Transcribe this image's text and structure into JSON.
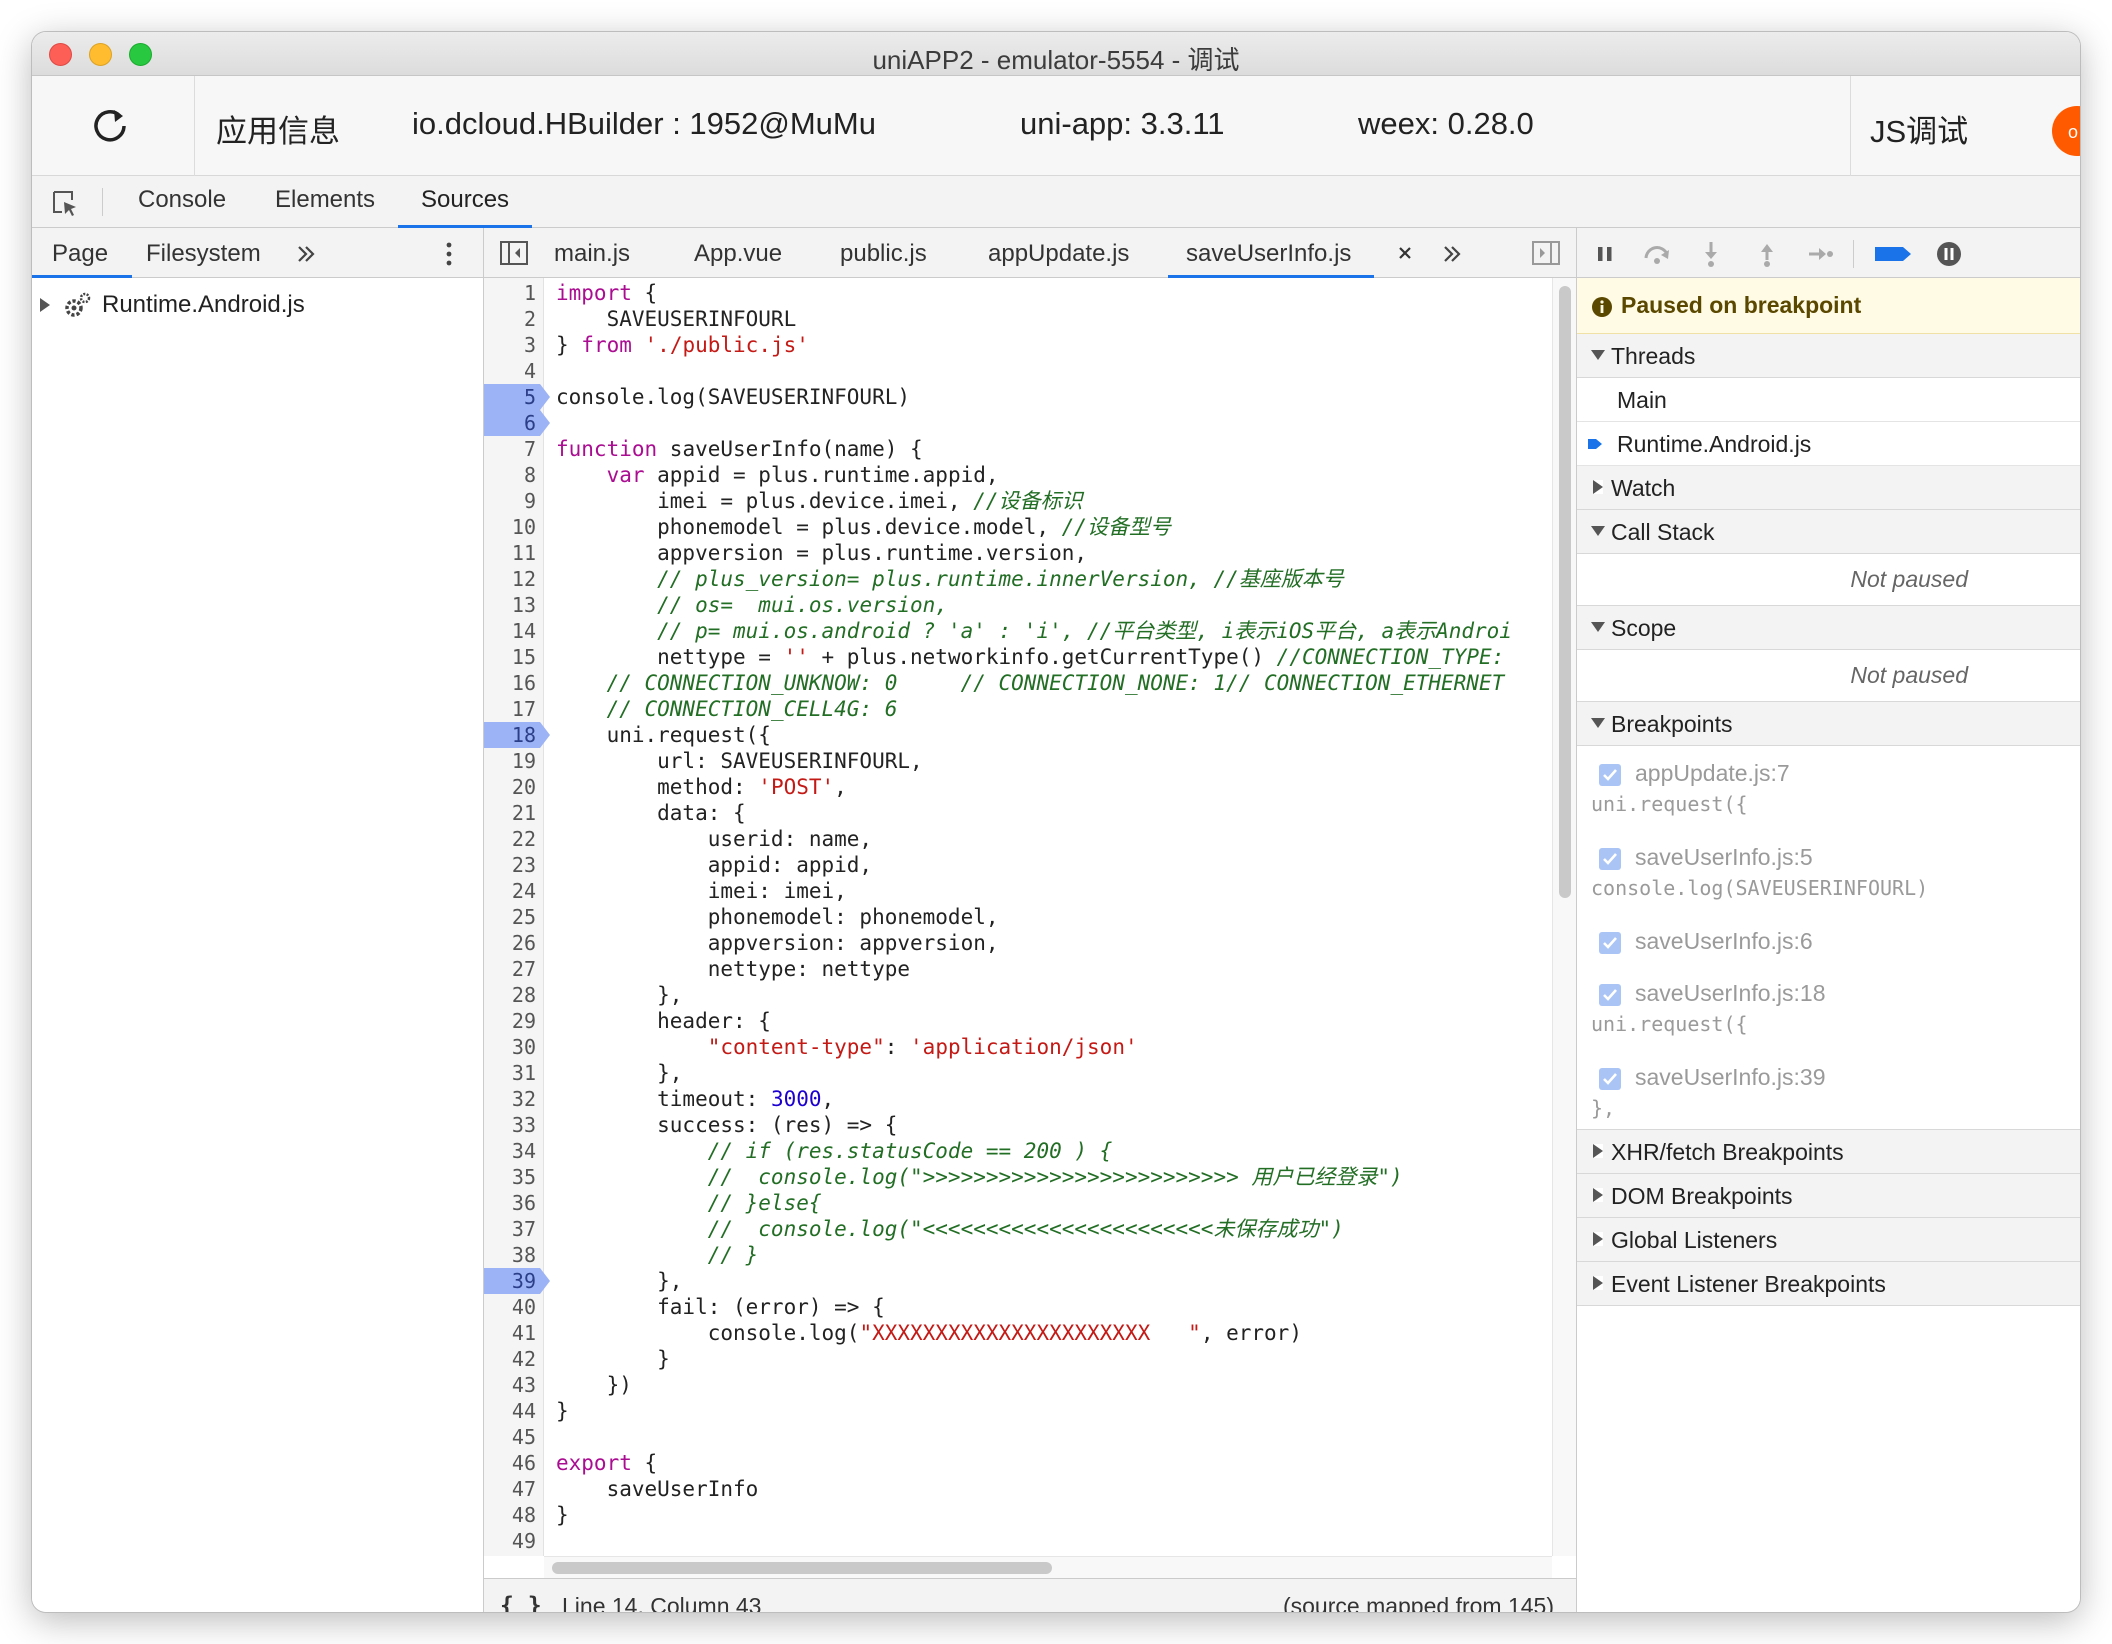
{
  "window": {
    "title": "uniAPP2 - emulator-5554 - 调试"
  },
  "infobar": {
    "app_info_label": "应用信息",
    "package": "io.dcloud.HBuilder : 1952@MuMu",
    "uniapp_version": "uni-app: 3.3.11",
    "weex_version": "weex: 0.28.0",
    "js_debug_label": "JS调试",
    "avatar_letter": "o"
  },
  "tabs": [
    "Console",
    "Elements",
    "Sources"
  ],
  "left_panel": {
    "tabs": [
      "Page",
      "Filesystem"
    ],
    "tree": [
      "Runtime.Android.js"
    ]
  },
  "file_tabs": [
    "main.js",
    "App.vue",
    "public.js",
    "appUpdate.js",
    "saveUserInfo.js"
  ],
  "code": {
    "lines": [
      "import {",
      "    SAVEUSERINFOURL",
      "} from './public.js'",
      "",
      "console.log(SAVEUSERINFOURL)",
      "",
      "function saveUserInfo(name) {",
      "    var appid = plus.runtime.appid,",
      "        imei = plus.device.imei, //设备标识",
      "        phonemodel = plus.device.model, //设备型号",
      "        appversion = plus.runtime.version,",
      "        // plus_version= plus.runtime.innerVersion, //基座版本号",
      "        // os=  mui.os.version,",
      "        // p= mui.os.android ? 'a' : 'i', //平台类型, i表示iOS平台, a表示Androi",
      "        nettype = '' + plus.networkinfo.getCurrentType() //CONNECTION_TYPE:",
      "    // CONNECTION_UNKNOW: 0     // CONNECTION_NONE: 1// CONNECTION_ETHERNET",
      "    // CONNECTION_CELL4G: 6",
      "    uni.request({",
      "        url: SAVEUSERINFOURL,",
      "        method: 'POST',",
      "        data: {",
      "            userid: name,",
      "            appid: appid,",
      "            imei: imei,",
      "            phonemodel: phonemodel,",
      "            appversion: appversion,",
      "            nettype: nettype",
      "        },",
      "        header: {",
      "            \"content-type\": 'application/json'",
      "        },",
      "        timeout: 3000,",
      "        success: (res) => {",
      "            // if (res.statusCode == 200 ) {",
      "            //  console.log(\">>>>>>>>>>>>>>>>>>>>>>>>> 用户已经登录\")",
      "            // }else{",
      "            //  console.log(\"<<<<<<<<<<<<<<<<<<<<<<<未保存成功\")",
      "            // }",
      "        },",
      "        fail: (error) => {",
      "            console.log(\"XXXXXXXXXXXXXXXXXXXXXX   \", error)",
      "        }",
      "    })",
      "}",
      "",
      "export {",
      "    saveUserInfo",
      "}",
      ""
    ],
    "breakpoint_lines": [
      5,
      6,
      18,
      39
    ]
  },
  "status": {
    "position": "Line 14, Column 43",
    "source_map": "(source mapped from 145)",
    "pretty_icon": "{ }"
  },
  "debugger": {
    "paused_msg": "Paused on breakpoint",
    "threads_label": "Threads",
    "threads": [
      "Main",
      "Runtime.Android.js"
    ],
    "watch_label": "Watch",
    "callstack_label": "Call Stack",
    "callstack_status": "Not paused",
    "scope_label": "Scope",
    "scope_status": "Not paused",
    "breakpoints_label": "Breakpoints",
    "breakpoints": [
      {
        "name": "appUpdate.js:7",
        "code": "uni.request({"
      },
      {
        "name": "saveUserInfo.js:5",
        "code": "console.log(SAVEUSERINFOURL)"
      },
      {
        "name": "saveUserInfo.js:6",
        "code": ""
      },
      {
        "name": "saveUserInfo.js:18",
        "code": "uni.request({"
      },
      {
        "name": "saveUserInfo.js:39",
        "code": "},"
      }
    ],
    "xhr_label": "XHR/fetch Breakpoints",
    "dom_label": "DOM Breakpoints",
    "global_label": "Global Listeners",
    "event_label": "Event Listener Breakpoints"
  },
  "colors": {
    "accent": "#1a73e8",
    "breakpoint": "#9cb3f5",
    "paused_bg": "#fffbe4",
    "avatar": "#ff5a00"
  }
}
